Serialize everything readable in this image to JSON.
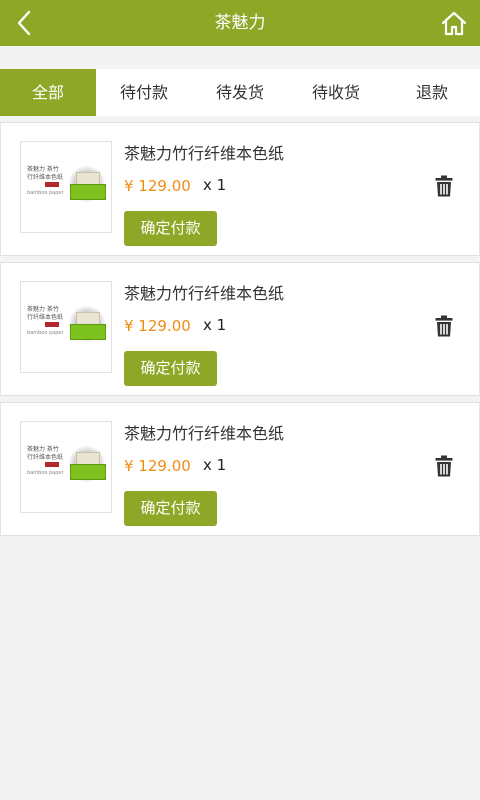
{
  "header": {
    "title": "茶魅力",
    "back_icon": "chevron-left-icon",
    "home_icon": "home-icon",
    "bg_color": "#8fa726"
  },
  "tabs": [
    {
      "label": "全部",
      "active": true
    },
    {
      "label": "待付款",
      "active": false
    },
    {
      "label": "待发货",
      "active": false
    },
    {
      "label": "待收货",
      "active": false
    },
    {
      "label": "退款",
      "active": false
    }
  ],
  "orders": [
    {
      "name": "茶魅力竹行纤维本色纸",
      "price": "¥ 129.00",
      "qty": "x 1",
      "pay_label": "确定付款",
      "thumb": {
        "line1": "茶魅力 茶竹",
        "line2": "行纤维本色纸",
        "line3": "bamboo paper"
      }
    },
    {
      "name": "茶魅力竹行纤维本色纸",
      "price": "¥ 129.00",
      "qty": "x 1",
      "pay_label": "确定付款",
      "thumb": {
        "line1": "茶魅力 茶竹",
        "line2": "行纤维本色纸",
        "line3": "bamboo paper"
      }
    },
    {
      "name": "茶魅力竹行纤维本色纸",
      "price": "¥ 129.00",
      "qty": "x 1",
      "pay_label": "确定付款",
      "thumb": {
        "line1": "茶魅力 茶竹",
        "line2": "行纤维本色纸",
        "line3": "bamboo paper"
      }
    }
  ],
  "colors": {
    "accent": "#8fa726",
    "price": "#f08c12",
    "background": "#f3f3f3"
  }
}
